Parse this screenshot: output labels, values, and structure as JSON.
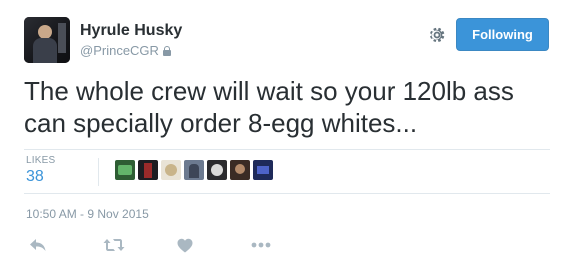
{
  "user": {
    "display_name": "Hyrule Husky",
    "handle": "@PrinceCGR",
    "protected": true
  },
  "header": {
    "follow_label": "Following",
    "settings_icon": "gear-icon"
  },
  "tweet": {
    "text": "The whole crew will wait so your 120lb ass can specially order 8-egg whites..."
  },
  "stats": {
    "likes_label": "LIKES",
    "likes_count": "38",
    "likers_count": 8
  },
  "meta": {
    "timestamp": "10:50 AM - 9 Nov 2015"
  },
  "actions": [
    "reply-icon",
    "retweet-icon",
    "like-icon",
    "more-icon"
  ],
  "colors": {
    "accent": "#3b94d9",
    "text": "#292f33",
    "muted": "#8899a6",
    "divider": "#e1e8ed"
  }
}
